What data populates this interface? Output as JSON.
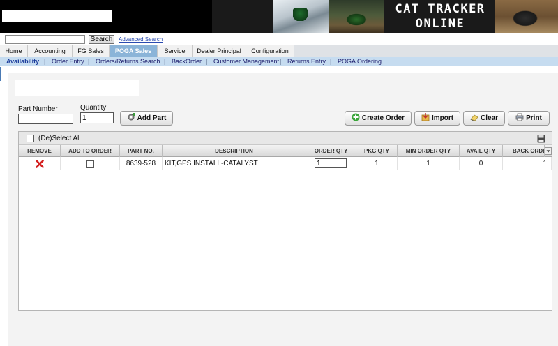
{
  "header": {
    "brand_line1": "CAT TRACKER",
    "brand_line2": "ONLINE"
  },
  "search": {
    "value": "",
    "button_label": "Search",
    "advanced_link": "Advanced Search"
  },
  "tabs": [
    {
      "label": "Home"
    },
    {
      "label": "Accounting"
    },
    {
      "label": "FG Sales"
    },
    {
      "label": "POGA Sales",
      "active": true
    },
    {
      "label": "Service"
    },
    {
      "label": "Dealer Principal"
    },
    {
      "label": "Configuration"
    }
  ],
  "subnav": [
    {
      "label": "Availability",
      "active": true
    },
    {
      "label": "Order Entry"
    },
    {
      "label": "Orders/Returns Search"
    },
    {
      "label": "BackOrder"
    },
    {
      "label": "Customer Management"
    },
    {
      "label": "Returns Entry"
    },
    {
      "label": "POGA Ordering"
    }
  ],
  "form": {
    "part_number_label": "Part Number",
    "part_number_value": "",
    "quantity_label": "Quantity",
    "quantity_value": "1",
    "add_part_label": "Add Part"
  },
  "actions": {
    "create_order": "Create Order",
    "import": "Import",
    "clear": "Clear",
    "print": "Print"
  },
  "grid": {
    "select_all_label": "(De)Select All",
    "columns": [
      "REMOVE",
      "ADD TO ORDER",
      "PART NO.",
      "DESCRIPTION",
      "ORDER QTY",
      "PKG QTY",
      "MIN ORDER QTY",
      "AVAIL QTY",
      "BACK ORDER"
    ],
    "rows": [
      {
        "part_no": "8639-528",
        "description": "KIT,GPS INSTALL-CATALYST",
        "order_qty": "1",
        "pkg_qty": "1",
        "min_order_qty": "1",
        "avail_qty": "0",
        "back_order": "1"
      }
    ]
  },
  "colors": {
    "active_tab": "#8bb4d8",
    "subnav_bg": "#c6dcf0",
    "remove_icon": "#d42020"
  }
}
